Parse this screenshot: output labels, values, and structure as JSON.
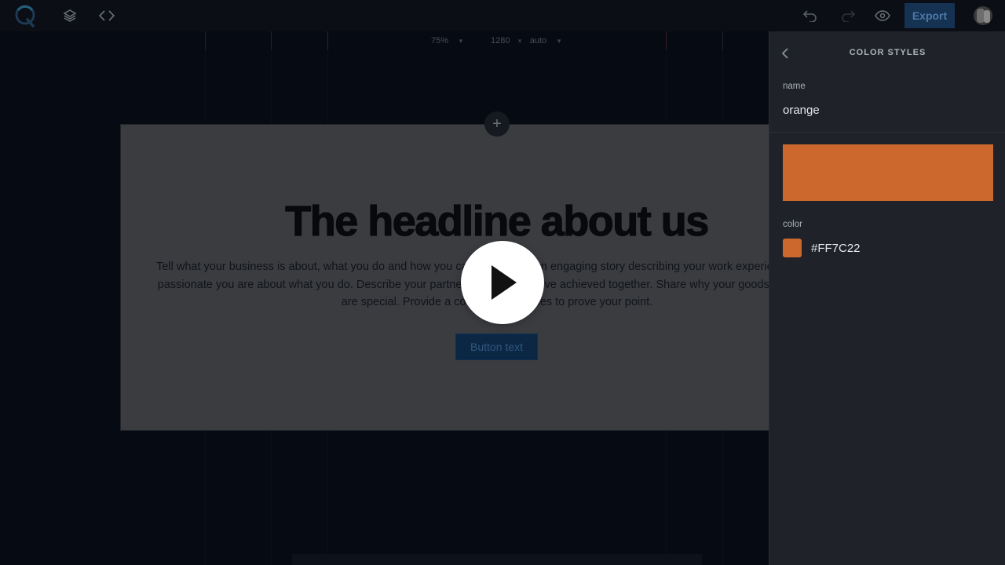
{
  "toolbar": {
    "logo_letter": "Q",
    "export_label": "Export"
  },
  "sizebar": {
    "zoom": "75%",
    "width": "1280",
    "times": "×",
    "height": "auto"
  },
  "section": {
    "headline": "The headline about us",
    "body_lines": [
      "Tell what your business is about, what you do and how you can help. Write an engaging story describing your work experience and how",
      "passionate you are about what you do. Describe your partners and what you've achieved together. Share why your goods and services",
      "are special. Provide a couple of examples to prove your point."
    ],
    "button_label": "Button text",
    "add_symbol": "+"
  },
  "panel": {
    "title": "COLOR STYLES",
    "name_label": "name",
    "name_value": "orange",
    "color_label": "color",
    "hex_value": "#FF7C22"
  },
  "colors": {
    "swatch": "#FF7C22",
    "accent_button": "#1565c0"
  }
}
